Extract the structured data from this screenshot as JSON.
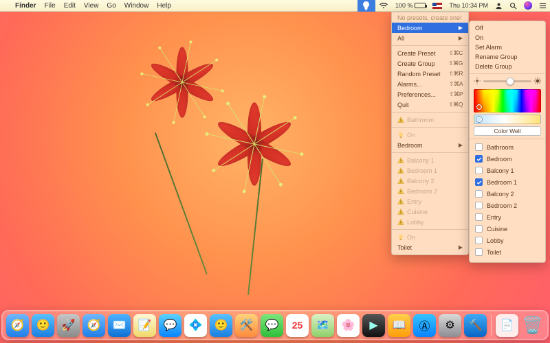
{
  "menubar": {
    "app": "Finder",
    "items": [
      "File",
      "Edit",
      "View",
      "Go",
      "Window",
      "Help"
    ],
    "battery_pct": "100 %",
    "clock": "Thu 10:34 PM"
  },
  "menu": {
    "hint": "No presets, create one!",
    "bedroom": "Bedroom",
    "all": "All",
    "create_preset": {
      "label": "Create Preset",
      "sc": "⇧⌘C"
    },
    "create_group": {
      "label": "Create Group",
      "sc": "⇧⌘G"
    },
    "random_preset": {
      "label": "Random Preset",
      "sc": "⇧⌘R"
    },
    "alarms": {
      "label": "Alarms...",
      "sc": "⇧⌘A"
    },
    "preferences": {
      "label": "Preferences...",
      "sc": "⇧⌘P"
    },
    "quit": {
      "label": "Quit",
      "sc": "⇧⌘Q"
    },
    "rooms_a": [
      "Bathroom"
    ],
    "on_a": "On",
    "bedroom_sub": "Bedroom",
    "rooms_b": [
      "Balcony 1",
      "Bedroom 1",
      "Balcony 2",
      "Bedroom 2",
      "Entry",
      "Cuisine",
      "Lobby"
    ],
    "on_b": "On",
    "toilet_sub": "Toilet"
  },
  "submenu": {
    "actions": [
      "Off",
      "On",
      "Set Alarm",
      "Rename Group",
      "Delete Group"
    ],
    "slider_pct": 55,
    "color_well": "Color Well",
    "rooms": [
      {
        "label": "Bathroom",
        "checked": false
      },
      {
        "label": "Bedroom",
        "checked": true
      },
      {
        "label": "Balcony 1",
        "checked": false
      },
      {
        "label": "Bedroom 1",
        "checked": true
      },
      {
        "label": "Balcony 2",
        "checked": false
      },
      {
        "label": "Bedroom 2",
        "checked": false
      },
      {
        "label": "Entry",
        "checked": false
      },
      {
        "label": "Cuisine",
        "checked": false
      },
      {
        "label": "Lobby",
        "checked": false
      },
      {
        "label": "Toilet",
        "checked": false
      }
    ]
  },
  "dock": [
    {
      "name": "safari",
      "bg": "linear-gradient(#6fb7ff,#1f7fe8)",
      "glyph": "🧭"
    },
    {
      "name": "finder",
      "bg": "linear-gradient(#57c1ff,#1b7fe0)",
      "glyph": "🙂"
    },
    {
      "name": "launchpad",
      "bg": "linear-gradient(#c6c6c6,#8b8b8b)",
      "glyph": "🚀"
    },
    {
      "name": "safari-2",
      "bg": "linear-gradient(#6fb7ff,#1f7fe8)",
      "glyph": "🧭"
    },
    {
      "name": "mail",
      "bg": "linear-gradient(#4fb2ff,#0d71d6)",
      "glyph": "✉️"
    },
    {
      "name": "notes",
      "bg": "linear-gradient(#fff7d6,#f1d96a)",
      "glyph": "📝"
    },
    {
      "name": "messages-blue",
      "bg": "linear-gradient(#5bd1ff,#0a84ff)",
      "glyph": "💬"
    },
    {
      "name": "slack",
      "bg": "#fff",
      "glyph": "💠"
    },
    {
      "name": "finder-2",
      "bg": "linear-gradient(#57c1ff,#1b7fe0)",
      "glyph": "🙂"
    },
    {
      "name": "calendar-tool",
      "bg": "linear-gradient(#ffd27a,#ff8a3c)",
      "glyph": "🛠️"
    },
    {
      "name": "messages",
      "bg": "linear-gradient(#7CE67C,#2FBF3A)",
      "glyph": "💬"
    },
    {
      "name": "calendar",
      "bg": "#fff",
      "glyph": "25"
    },
    {
      "name": "maps",
      "bg": "linear-gradient(#d9f0c4,#8fd16a)",
      "glyph": "🗺️"
    },
    {
      "name": "photos",
      "bg": "#fff",
      "glyph": "🌸"
    },
    {
      "name": "quicktime",
      "bg": "linear-gradient(#555,#111)",
      "glyph": "▶︎"
    },
    {
      "name": "books",
      "bg": "linear-gradient(#ffcf4b,#ff9f0a)",
      "glyph": "📖"
    },
    {
      "name": "appstore",
      "bg": "linear-gradient(#36c3ff,#0a84ff)",
      "glyph": "Ⓐ"
    },
    {
      "name": "settings",
      "bg": "linear-gradient(#d9d9d9,#8e8e93)",
      "glyph": "⚙︎"
    },
    {
      "name": "xcode",
      "bg": "linear-gradient(#3fa9f5,#0866c6)",
      "glyph": "🔨"
    }
  ],
  "dock_right": [
    {
      "name": "document",
      "bg": "rgba(255,255,255,.85)",
      "glyph": "📄"
    },
    {
      "name": "trash",
      "bg": "rgba(255,255,255,.0)",
      "glyph": "🗑️"
    }
  ]
}
